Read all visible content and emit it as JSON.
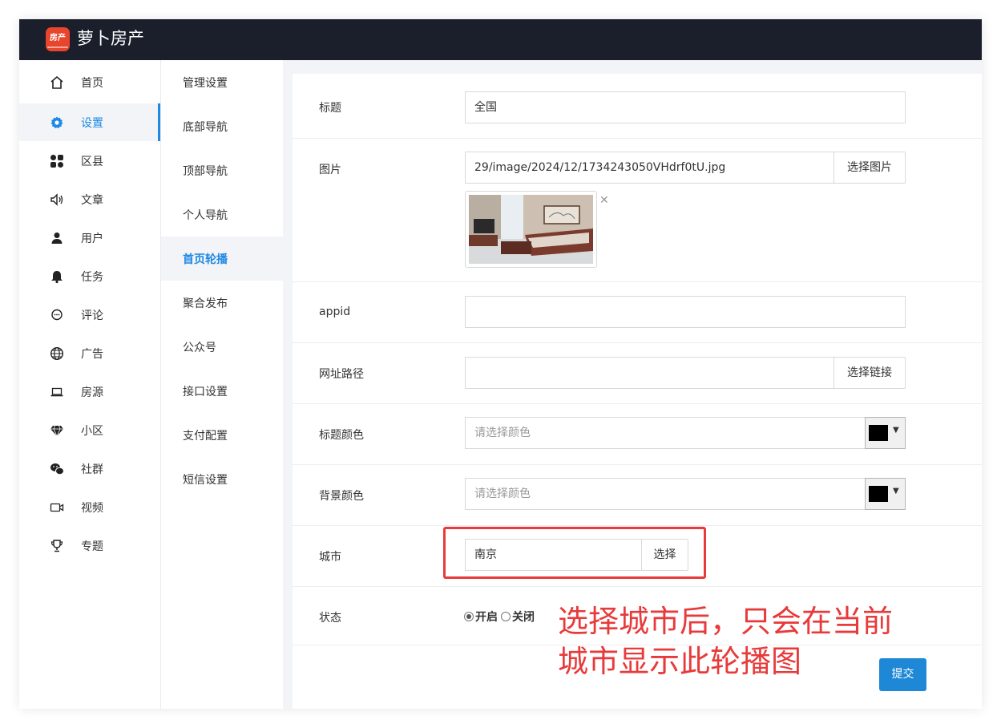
{
  "app": {
    "logo_text": "房产",
    "brand": "萝卜房产"
  },
  "sidebar": {
    "items": [
      {
        "label": "首页",
        "icon": "home-icon"
      },
      {
        "label": "设置",
        "icon": "gear-icon",
        "active": true
      },
      {
        "label": "区县",
        "icon": "grid-icon"
      },
      {
        "label": "文章",
        "icon": "speaker-icon"
      },
      {
        "label": "用户",
        "icon": "user-icon"
      },
      {
        "label": "任务",
        "icon": "bell-icon"
      },
      {
        "label": "评论",
        "icon": "comment-icon"
      },
      {
        "label": "广告",
        "icon": "globe-icon"
      },
      {
        "label": "房源",
        "icon": "laptop-icon"
      },
      {
        "label": "小区",
        "icon": "diamond-icon"
      },
      {
        "label": "社群",
        "icon": "wechat-icon"
      },
      {
        "label": "视频",
        "icon": "video-icon"
      },
      {
        "label": "专题",
        "icon": "trophy-icon"
      }
    ]
  },
  "subnav": {
    "items": [
      "管理设置",
      "底部导航",
      "顶部导航",
      "个人导航",
      "首页轮播",
      "聚合发布",
      "公众号",
      "接口设置",
      "支付配置",
      "短信设置"
    ],
    "active": "首页轮播"
  },
  "form": {
    "title": {
      "label": "标题",
      "value": "全国"
    },
    "image": {
      "label": "图片",
      "value": "29/image/2024/12/1734243050VHdrf0tU.jpg",
      "button": "选择图片",
      "remove_icon": "close-icon"
    },
    "appid": {
      "label": "appid",
      "value": ""
    },
    "url": {
      "label": "网址路径",
      "value": "",
      "button": "选择链接"
    },
    "title_color": {
      "label": "标题颜色",
      "placeholder": "请选择颜色",
      "color": "#000000"
    },
    "bg_color": {
      "label": "背景颜色",
      "placeholder": "请选择颜色",
      "color": "#000000"
    },
    "city": {
      "label": "城市",
      "value": "南京",
      "button": "选择"
    },
    "status": {
      "label": "状态",
      "options": [
        "开启",
        "关闭"
      ],
      "selected": "开启"
    },
    "submit": "提交"
  },
  "annotation": "选择城市后，只会在当前\n城市显示此轮播图",
  "colors": {
    "topbar": "#1a1f2b",
    "accent": "#1e88e5",
    "annotation": "#e83a3a",
    "submit": "#1e88d6"
  }
}
